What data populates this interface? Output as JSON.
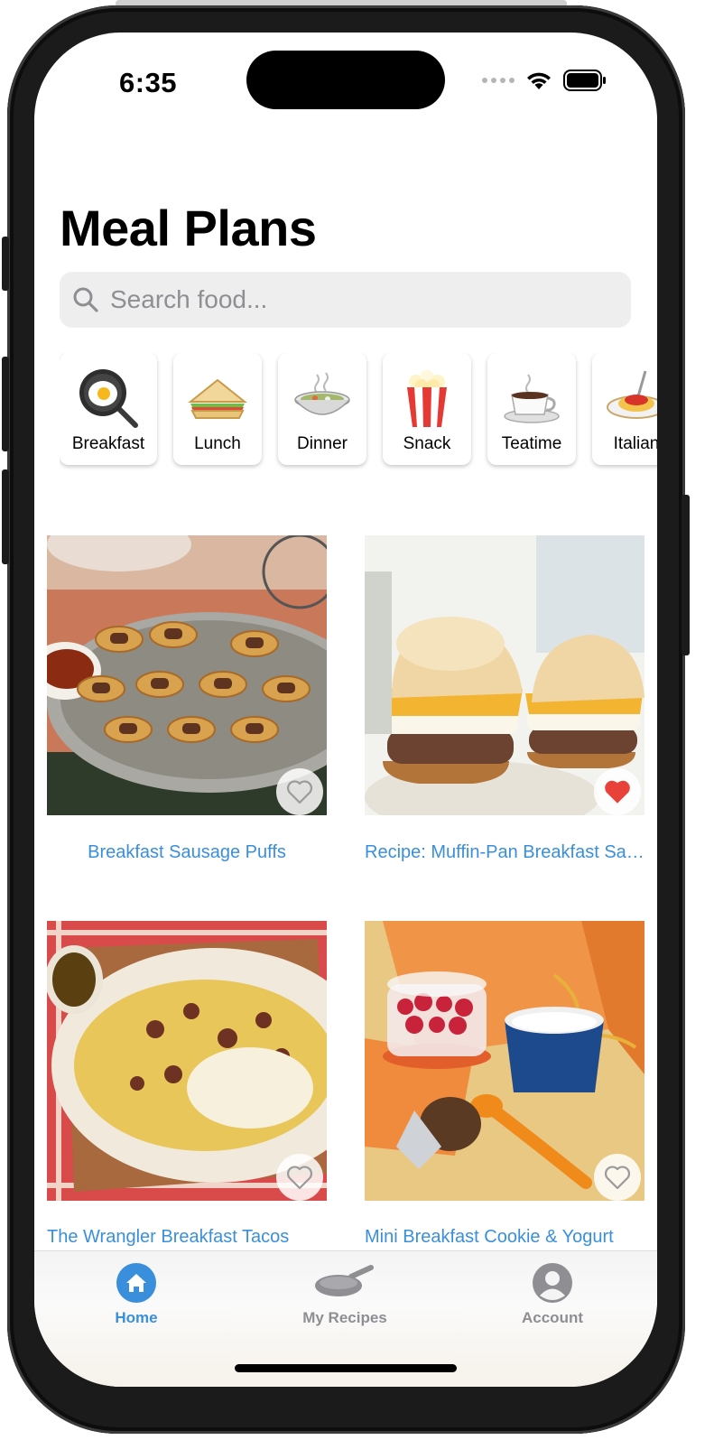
{
  "status": {
    "time": "6:35"
  },
  "page": {
    "title": "Meal Plans"
  },
  "search": {
    "placeholder": "Search food...",
    "value": ""
  },
  "categories": [
    {
      "label": "Breakfast",
      "icon": "frying-pan-egg-icon"
    },
    {
      "label": "Lunch",
      "icon": "sandwich-icon"
    },
    {
      "label": "Dinner",
      "icon": "bowl-icon"
    },
    {
      "label": "Snack",
      "icon": "popcorn-icon"
    },
    {
      "label": "Teatime",
      "icon": "teacup-icon"
    },
    {
      "label": "Italian",
      "icon": "spaghetti-icon"
    }
  ],
  "recipes": [
    {
      "title": "Breakfast Sausage Puffs",
      "favorite": false
    },
    {
      "title": "Recipe: Muffin-Pan Breakfast Sandwiches",
      "favorite": true
    },
    {
      "title": "The Wrangler Breakfast Tacos",
      "favorite": false
    },
    {
      "title": "Mini Breakfast Cookie & Yogurt",
      "favorite": false
    }
  ],
  "tabs": [
    {
      "label": "Home",
      "icon": "house-icon",
      "active": true
    },
    {
      "label": "My Recipes",
      "icon": "pan-icon",
      "active": false
    },
    {
      "label": "Account",
      "icon": "person-icon",
      "active": false
    }
  ],
  "colors": {
    "accent": "#3a8fdc",
    "favorite": "#e8413a",
    "inactive": "#8e8e93"
  }
}
